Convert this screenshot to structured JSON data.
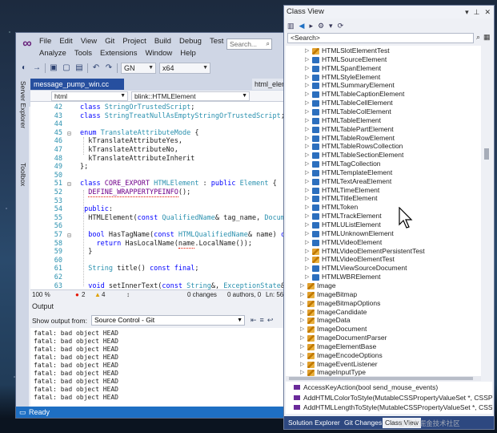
{
  "vs": {
    "menu_row1": [
      "File",
      "Edit",
      "View",
      "Git",
      "Project",
      "Build",
      "Debug",
      "Test"
    ],
    "menu_row2": [
      "Analyze",
      "Tools",
      "Extensions",
      "Window",
      "Help"
    ],
    "search_placeholder": "Search...",
    "toolbar": {
      "config": "GN",
      "platform": "x64"
    },
    "side_labels": [
      "Server Explorer",
      "Toolbox"
    ],
    "tabs": {
      "active": "message_pump_win.cc",
      "other": "html_elem"
    },
    "nav": {
      "project": "html",
      "scope": "blink::HTMLElement"
    },
    "code_lines": [
      {
        "n": "42",
        "html": "<span class=\"kw\">class</span> <span class=\"ty\">StringOrTrustedScript</span>;"
      },
      {
        "n": "43",
        "html": "<span class=\"kw\">class</span> <span class=\"ty\">StringTreatNullAsEmptyStringOrTrustedScript</span>;"
      },
      {
        "n": "44",
        "html": ""
      },
      {
        "n": "45",
        "html": "<span class=\"kw\">enum</span> <span class=\"ty\">TranslateAttributeMode</span> {"
      },
      {
        "n": "46",
        "html": "  kTranslateAttributeYes,"
      },
      {
        "n": "47",
        "html": "  kTranslateAttributeNo,"
      },
      {
        "n": "48",
        "html": "  kTranslateAttributeInherit"
      },
      {
        "n": "49",
        "html": "};"
      },
      {
        "n": "50",
        "html": ""
      },
      {
        "n": "51",
        "html": "<span class=\"kw\">class</span> <span class=\"mac\">CORE_EXPORT</span> <span class=\"ty\">HTMLElement</span> : <span class=\"kw\">public</span> <span class=\"ty\">Element</span> {"
      },
      {
        "n": "52",
        "html": "  <span class=\"mac sq\">DEFINE_WRAPPERTYPEINFO</span>();"
      },
      {
        "n": "53",
        "html": ""
      },
      {
        "n": "54",
        "html": " <span class=\"kw\">public</span>:"
      },
      {
        "n": "55",
        "html": "  HTMLElement(<span class=\"kw\">const</span> <span class=\"ty\">QualifiedName</span>&amp; tag_name, <span class=\"ty\">Document</span>"
      },
      {
        "n": "56",
        "html": ""
      },
      {
        "n": "57",
        "html": "  <span class=\"kw\">bool</span> HasTagName(<span class=\"kw\">const</span> <span class=\"ty\">HTMLQualifiedName</span>&amp; name) <span class=\"kw\">cons</span>"
      },
      {
        "n": "58",
        "html": "    <span class=\"kw\">return</span> HasLocalName(<span class=\"sq\">name</span>.LocalName());"
      },
      {
        "n": "59",
        "html": "  }"
      },
      {
        "n": "60",
        "html": ""
      },
      {
        "n": "61",
        "html": "  <span class=\"ty\">String</span> title() <span class=\"kw\">const</span> <span class=\"kw\">final</span>;"
      },
      {
        "n": "62",
        "html": ""
      },
      {
        "n": "63",
        "html": "  <span class=\"kw\">void</span> setInnerText(<span class=\"kw\">const</span> <span class=\"ty\">String</span>&amp;, <span class=\"ty\">ExceptionState</span>&amp;);"
      }
    ],
    "statusline": {
      "zoom": "100 %",
      "errors": "2",
      "warnings": "4",
      "changes": "0 changes",
      "authors": "0 authors, 0 changes",
      "line": "Ln: 56"
    },
    "output": {
      "title": "Output",
      "from_label": "Show output from:",
      "source": "Source Control - Git",
      "lines": [
        "fatal: bad object HEAD",
        "fatal: bad object HEAD",
        "fatal: bad object HEAD",
        "fatal: bad object HEAD",
        "fatal: bad object HEAD",
        "fatal: bad object HEAD",
        "fatal: bad object HEAD",
        "fatal: bad object HEAD",
        "fatal: bad object HEAD"
      ]
    },
    "status": "Ready"
  },
  "class_view": {
    "title": "Class View",
    "search_value": "<Search>",
    "items": [
      {
        "name": "HTMLSlotElementTest",
        "type": "class"
      },
      {
        "name": "HTMLSourceElement",
        "type": "struct"
      },
      {
        "name": "HTMLSpanElement",
        "type": "struct"
      },
      {
        "name": "HTMLStyleElement",
        "type": "struct"
      },
      {
        "name": "HTMLSummaryElement",
        "type": "struct"
      },
      {
        "name": "HTMLTableCaptionElement",
        "type": "struct"
      },
      {
        "name": "HTMLTableCellElement",
        "type": "struct"
      },
      {
        "name": "HTMLTableColElement",
        "type": "struct"
      },
      {
        "name": "HTMLTableElement",
        "type": "struct"
      },
      {
        "name": "HTMLTablePartElement",
        "type": "struct"
      },
      {
        "name": "HTMLTableRowElement",
        "type": "struct"
      },
      {
        "name": "HTMLTableRowsCollection",
        "type": "struct"
      },
      {
        "name": "HTMLTableSectionElement",
        "type": "struct"
      },
      {
        "name": "HTMLTagCollection",
        "type": "struct"
      },
      {
        "name": "HTMLTemplateElement",
        "type": "struct"
      },
      {
        "name": "HTMLTextAreaElement",
        "type": "struct"
      },
      {
        "name": "HTMLTimeElement",
        "type": "struct"
      },
      {
        "name": "HTMLTitleElement",
        "type": "struct"
      },
      {
        "name": "HTMLToken",
        "type": "struct"
      },
      {
        "name": "HTMLTrackElement",
        "type": "struct"
      },
      {
        "name": "HTMLUListElement",
        "type": "struct"
      },
      {
        "name": "HTMLUnknownElement",
        "type": "struct"
      },
      {
        "name": "HTMLVideoElement",
        "type": "struct"
      },
      {
        "name": "HTMLVideoElementPersistentTest",
        "type": "class"
      },
      {
        "name": "HTMLVideoElementTest",
        "type": "class"
      },
      {
        "name": "HTMLViewSourceDocument",
        "type": "struct"
      },
      {
        "name": "HTMLWBRElement",
        "type": "struct"
      },
      {
        "name": "Image",
        "type": "class",
        "low": true
      },
      {
        "name": "ImageBitmap",
        "type": "class",
        "low": true
      },
      {
        "name": "ImageBitmapOptions",
        "type": "class",
        "low": true
      },
      {
        "name": "ImageCandidate",
        "type": "class",
        "low": true
      },
      {
        "name": "ImageData",
        "type": "class",
        "low": true
      },
      {
        "name": "ImageDocument",
        "type": "class",
        "low": true
      },
      {
        "name": "ImageDocumentParser",
        "type": "class",
        "low": true
      },
      {
        "name": "ImageElementBase",
        "type": "class",
        "low": true
      },
      {
        "name": "ImageEncodeOptions",
        "type": "class",
        "low": true
      },
      {
        "name": "ImageEventListener",
        "type": "class",
        "low": true
      },
      {
        "name": "ImageInputType",
        "type": "class",
        "low": true
      }
    ],
    "members": [
      "AccessKeyAction(bool send_mouse_events)",
      "AddHTMLColorToStyle(MutableCSSPropertyValueSet *, CSSP",
      "AddHTMLLengthToStyle(MutableCSSPropertyValueSet *, CSSF"
    ],
    "tabs": [
      "Solution Explorer",
      "Git Changes",
      "Class View"
    ]
  },
  "watermark": "@稀土掘金技术社区"
}
